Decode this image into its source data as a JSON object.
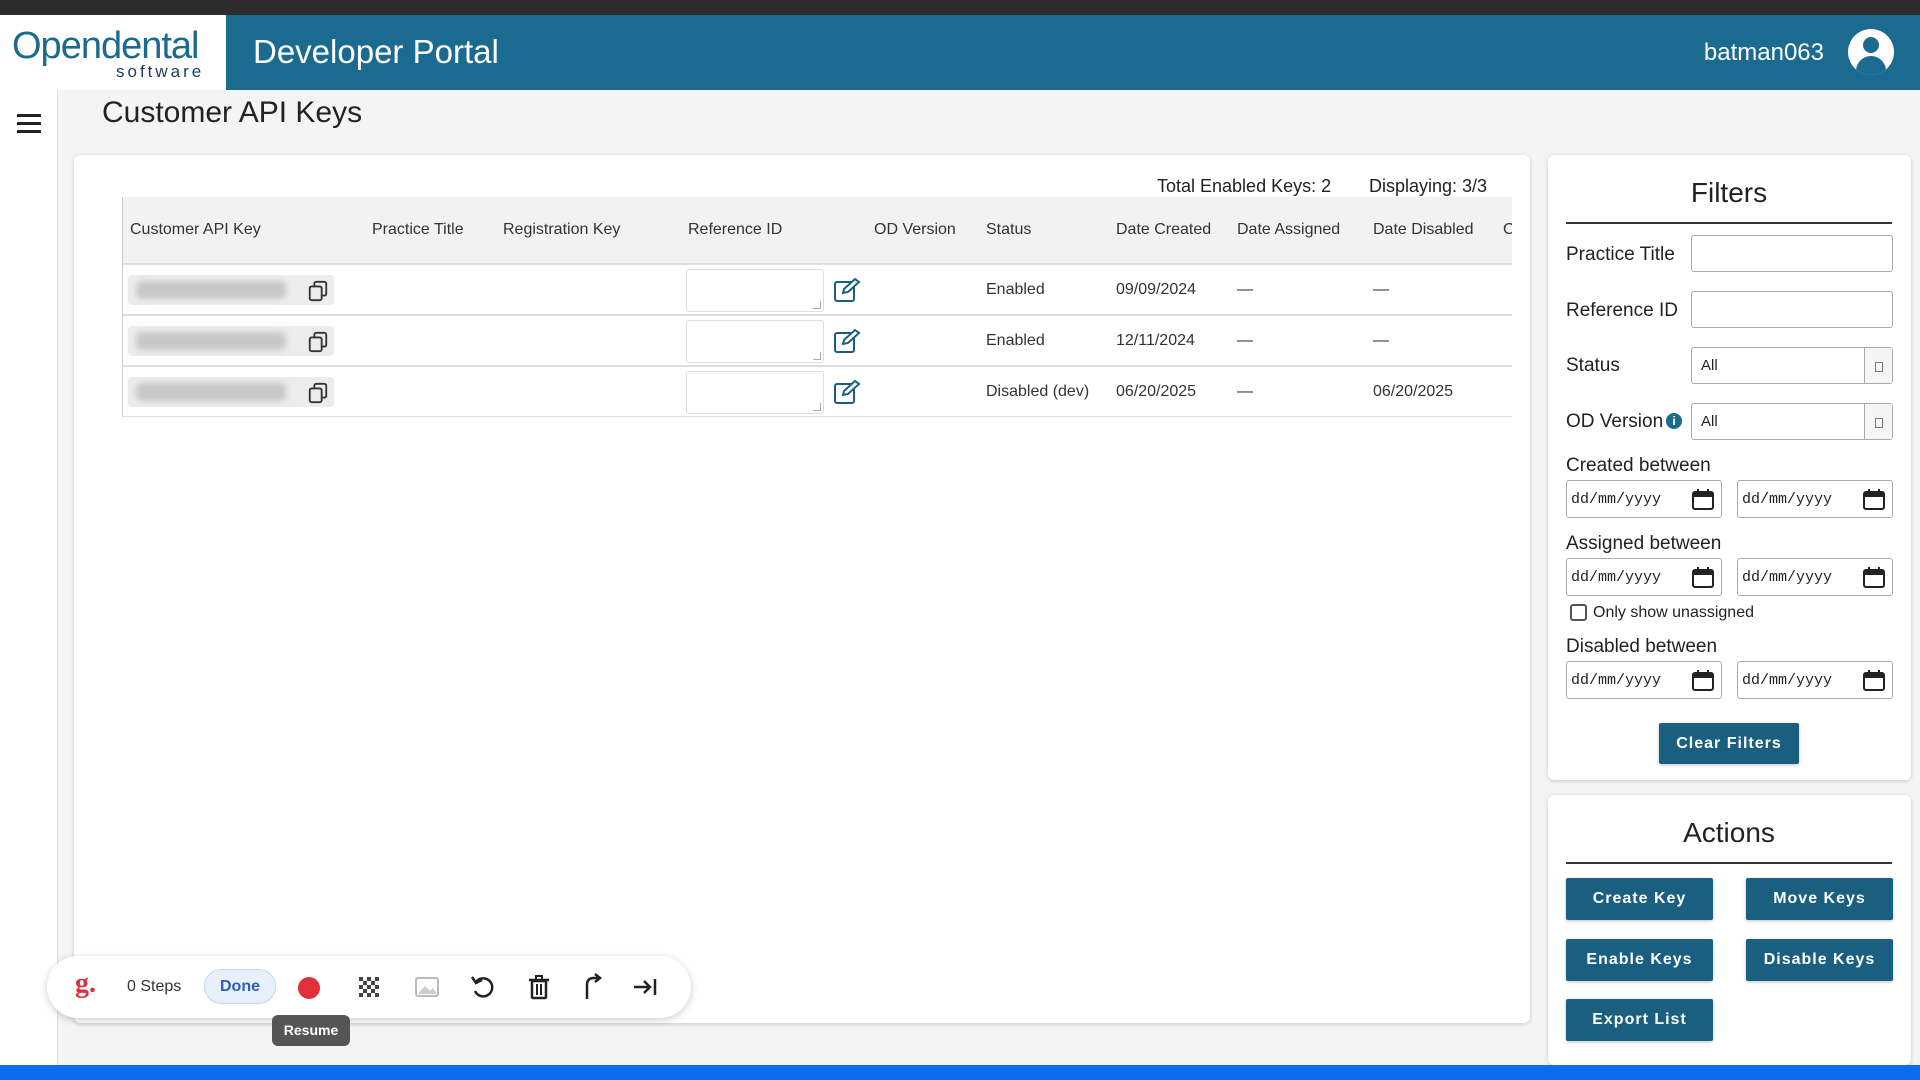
{
  "header": {
    "logo_main": "Opendental",
    "logo_sub": "software",
    "portal_title": "Developer Portal",
    "username": "batman063"
  },
  "page": {
    "title": "Customer API Keys"
  },
  "summary": {
    "total_enabled": "Total Enabled Keys: 2",
    "displaying": "Displaying: 3/3"
  },
  "table": {
    "columns": [
      "Customer API Key",
      "Practice Title",
      "Registration Key",
      "Reference ID",
      "OD Version",
      "Status",
      "Date Created",
      "Date Assigned",
      "Date Disabled",
      "C"
    ],
    "rows": [
      {
        "status": "Enabled",
        "date_created": "09/09/2024",
        "date_assigned": "—",
        "date_disabled": "—"
      },
      {
        "status": "Enabled",
        "date_created": "12/11/2024",
        "date_assigned": "—",
        "date_disabled": "—"
      },
      {
        "status": "Disabled (dev)",
        "date_created": "06/20/2025",
        "date_assigned": "—",
        "date_disabled": "06/20/2025"
      }
    ]
  },
  "recorder": {
    "logo": "g.",
    "steps": "0 Steps",
    "done": "Done",
    "tooltip": "Resume"
  },
  "filters": {
    "title": "Filters",
    "practice_title": "Practice Title",
    "reference_id": "Reference ID",
    "status_label": "Status",
    "status_value": "All",
    "od_version_label": "OD Version",
    "od_version_value": "All",
    "info_glyph": "i",
    "created_between": "Created between",
    "assigned_between": "Assigned between",
    "only_unassigned": "Only show unassigned",
    "disabled_between": "Disabled between",
    "date_placeholder": "dd/mm/yyyy",
    "clear": "Clear Filters"
  },
  "actions": {
    "title": "Actions",
    "create": "Create Key",
    "move": "Move Keys",
    "enable": "Enable Keys",
    "disable": "Disable Keys",
    "export": "Export List"
  },
  "colors": {
    "brand": "#1a6b8f",
    "button": "#1a5f80",
    "record": "#e0303a",
    "bottom_bar": "#0b6cf0"
  },
  "icons": [
    "copy-icon",
    "edit-icon",
    "calendar-icon",
    "hamburger-icon",
    "user-icon",
    "info-icon",
    "undo-icon",
    "trash-icon",
    "share-icon",
    "skip-end-icon",
    "record-icon",
    "blur-icon",
    "image-icon"
  ]
}
